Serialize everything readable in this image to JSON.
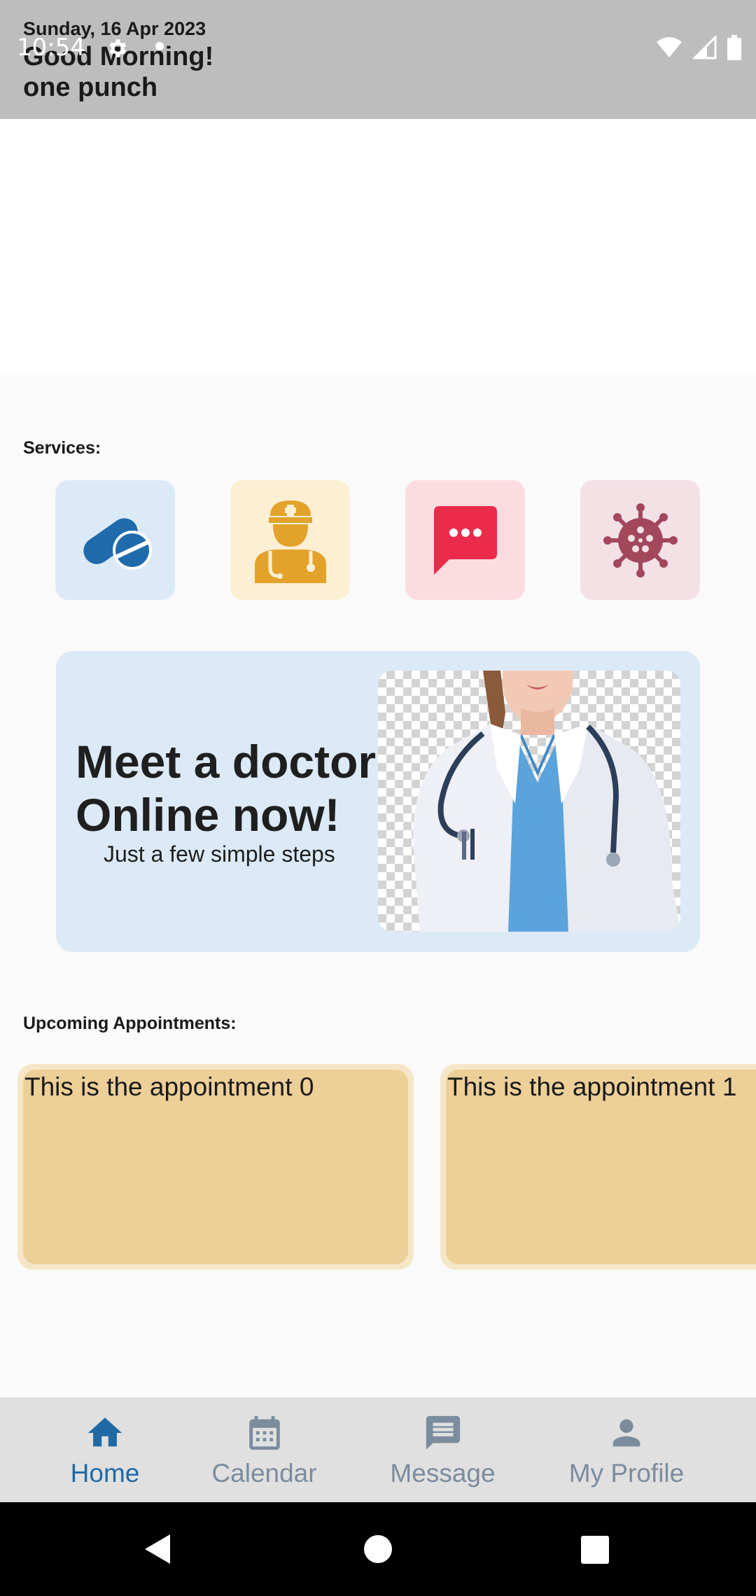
{
  "status_bar": {
    "time": "10:54",
    "left_icons": [
      "gear-icon",
      "dot-icon"
    ],
    "right_icons": [
      "wifi-icon",
      "signal-icon",
      "battery-icon"
    ]
  },
  "header": {
    "date": "Sunday, 16 Apr 2023",
    "greeting": "Good Morning!",
    "username": "one punch"
  },
  "services": {
    "title": "Services:",
    "items": [
      {
        "icon": "pills-icon",
        "bg": "#dceaf7",
        "fg": "#1f6bac"
      },
      {
        "icon": "doctor-icon",
        "bg": "#fcefd4",
        "fg": "#e3a22a"
      },
      {
        "icon": "chat-icon",
        "bg": "#fbdde1",
        "fg": "#ea2b4c"
      },
      {
        "icon": "virus-icon",
        "bg": "#f3e1e6",
        "fg": "#a3475d"
      }
    ]
  },
  "banner": {
    "title_line1": "Meet a doctor",
    "title_line2": "Online now!",
    "subtitle": "Just a few simple steps"
  },
  "appointments": {
    "title": "Upcoming Appointments:",
    "items": [
      {
        "text": "This is the appointment 0"
      },
      {
        "text": "This is the appointment 1"
      }
    ]
  },
  "bottom_nav": {
    "active_color": "#1f6aa5",
    "inactive_color": "#7b8c9e",
    "items": [
      {
        "label": "Home",
        "icon": "home-icon",
        "active": true
      },
      {
        "label": "Calendar",
        "icon": "calendar-icon",
        "active": false
      },
      {
        "label": "Message",
        "icon": "message-icon",
        "active": false
      },
      {
        "label": "My Profile",
        "icon": "person-icon",
        "active": false
      }
    ]
  },
  "system_nav": {
    "buttons": [
      "back-icon",
      "home-circle-icon",
      "recents-icon"
    ]
  }
}
